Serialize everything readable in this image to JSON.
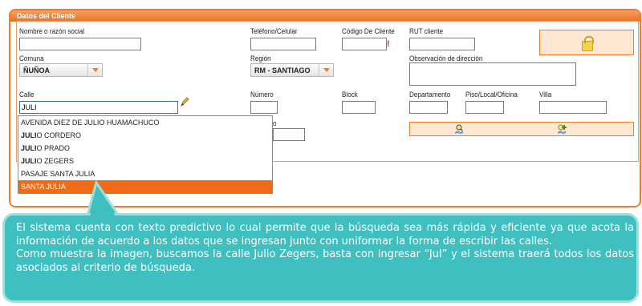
{
  "panel": {
    "title": "Datos del Cliente"
  },
  "fields": {
    "nombre_label": "Nombre o razón social",
    "nombre_value": "",
    "telefono_label": "Teléfono/Celular",
    "telefono_value": "",
    "codigo_label": "Código De Cliente",
    "codigo_value": "",
    "codigo_required": "!",
    "rut_label": "RUT cliente",
    "rut_value": "",
    "comuna_label": "Comuna",
    "comuna_value": "ÑUÑOA",
    "region_label": "Región",
    "region_value": "RM - SANTIAGO",
    "observacion_label": "Observación de dirección",
    "calle_label": "Calle",
    "calle_value": "JULI",
    "numero_label": "Número",
    "block_label": "Block",
    "departamento_label": "Departamento",
    "piso_label": "Piso/Local/Oficina",
    "villa_label": "Villa",
    "hidden_label_fragment": "o"
  },
  "autocomplete": {
    "items": [
      {
        "prefix": "",
        "rest": "AVENIDA DIEZ DE JULIO HUAMACHUCO",
        "active": false
      },
      {
        "prefix": "JULI",
        "rest": "O CORDERO",
        "active": false
      },
      {
        "prefix": "JULI",
        "rest": "O PRADO",
        "active": false
      },
      {
        "prefix": "JULI",
        "rest": "O ZEGERS",
        "active": false
      },
      {
        "prefix": "",
        "rest": "PASAJE SANTA JULIA",
        "active": false
      },
      {
        "prefix": "",
        "rest": "SANTA JULIA",
        "active": true
      }
    ]
  },
  "callout": {
    "text": "El sistema cuenta con texto predictivo lo cual permite que la búsqueda sea más rápida y eficiente ya que acota la información de acuerdo a los datos que se ingresan junto con uniformar la forma de escribir las calles. Como muestra la imagen, buscamos la calle Julio Zegers, basta con ingresar “Jul” y el sistema traerá todos los datos asociados al criterio de búsqueda.",
    "paragraph1": "El sistema cuenta con texto predictivo lo cual permite que la búsqueda sea más rápida y eficiente ya que acota la información de acuerdo a los datos que se ingresan junto con uniformar la forma de escribir las calles.",
    "paragraph2": "Como muestra la imagen, buscamos la calle Julio Zegers, basta con ingresar “Jul” y el sistema traerá todos los datos asociados al criterio de búsqueda."
  },
  "colors": {
    "accent": "#ef7d2c",
    "callout_bg": "#3fbfbf",
    "active_item": "#ef6b17"
  },
  "icons": [
    "lock-icon",
    "pencil-icon",
    "search-map-icon",
    "add-location-icon"
  ]
}
